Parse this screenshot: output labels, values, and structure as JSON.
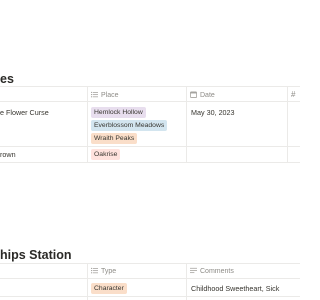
{
  "table1": {
    "title": "es",
    "headers": {
      "place": "Place",
      "date": "Date",
      "number_symbol": "#"
    },
    "rows": [
      {
        "name": "e Flower Curse",
        "places": [
          "Hemlock Hollow",
          "Everblossom Meadows",
          "Wraith Peaks"
        ],
        "date": "May 30, 2023"
      },
      {
        "name": "rown",
        "places": [
          "Oakrise"
        ],
        "date": ""
      }
    ]
  },
  "table2": {
    "title": "hips Station",
    "headers": {
      "type": "Type",
      "comments": "Comments"
    },
    "rows": [
      {
        "type": "Character",
        "comments": "Childhood Sweetheart, Sick"
      }
    ]
  },
  "colors": {
    "tag_purple": "#e8deee",
    "tag_blue": "#d3e5ef",
    "tag_orange": "#fadec9",
    "tag_red": "#ffe2dd",
    "divider": "#ebeae8"
  }
}
